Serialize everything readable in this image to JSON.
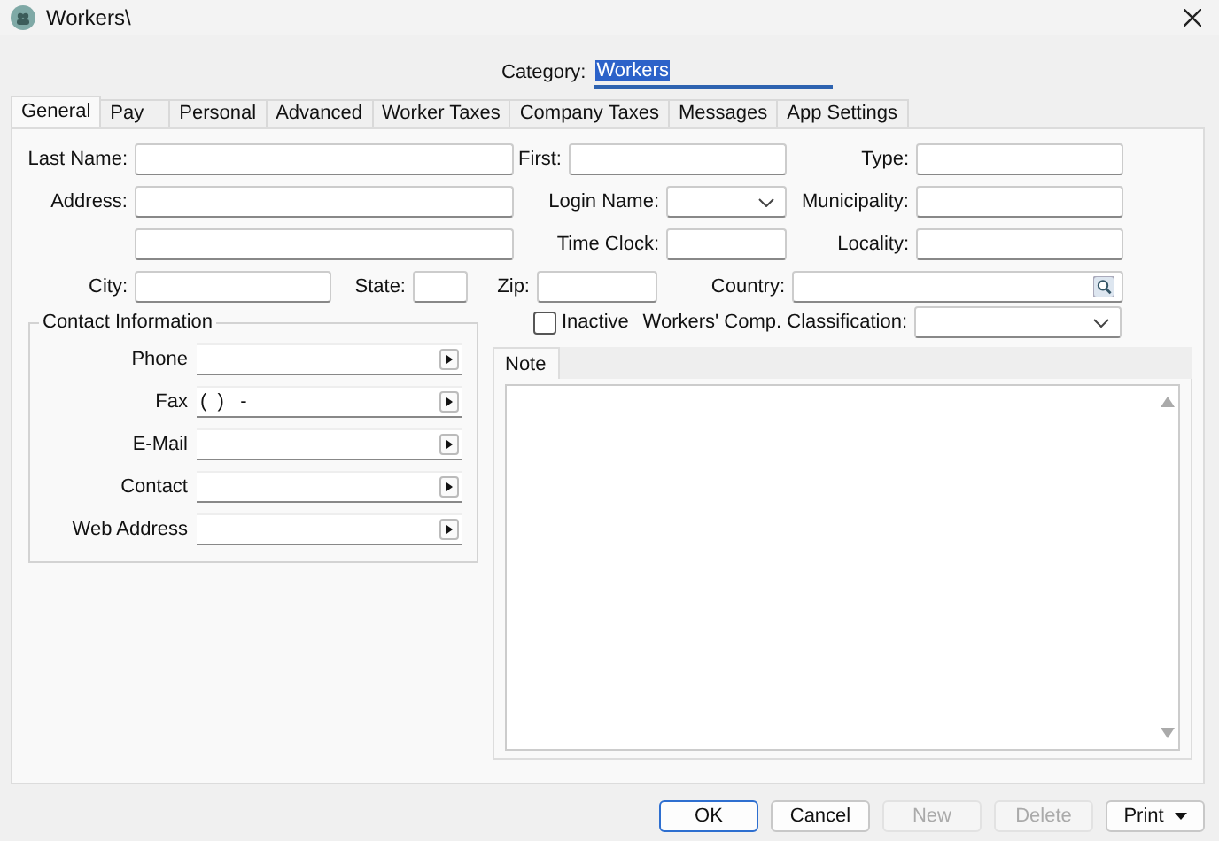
{
  "window": {
    "title": "Workers\\"
  },
  "category": {
    "label": "Category:",
    "value": "Workers",
    "highlighted": true
  },
  "tabs": [
    {
      "label": "General",
      "selected": true
    },
    {
      "label": "Pay",
      "selected": false
    },
    {
      "label": "Personal",
      "selected": false
    },
    {
      "label": "Advanced",
      "selected": false
    },
    {
      "label": "Worker Taxes",
      "selected": false
    },
    {
      "label": "Company Taxes",
      "selected": false
    },
    {
      "label": "Messages",
      "selected": false
    },
    {
      "label": "App Settings",
      "selected": false
    }
  ],
  "form_rows": [
    [
      {
        "label": "Last Name:",
        "kind": "text"
      },
      {
        "label": "First:",
        "kind": "text"
      },
      {
        "label": "Type:",
        "kind": "text"
      }
    ],
    [
      {
        "label": "Address:",
        "kind": "text"
      },
      {
        "label": "Login Name:",
        "kind": "select"
      },
      {
        "label": "Municipality:",
        "kind": "text"
      }
    ],
    [
      {
        "kind": "text"
      },
      {
        "label": "Time Clock:",
        "kind": "text"
      },
      {
        "label": "Locality:",
        "kind": "text"
      }
    ],
    [
      {
        "label": "City:",
        "kind": "text"
      },
      {
        "label": "State:",
        "kind": "text"
      },
      {
        "label": "Zip:",
        "kind": "text"
      },
      {
        "label": "Country:",
        "kind": "lookup"
      }
    ]
  ],
  "contact": {
    "title": "Contact Information",
    "rows": [
      {
        "label": "Phone"
      },
      {
        "label": "Fax",
        "value": "(  )   -"
      },
      {
        "label": "E-Mail"
      },
      {
        "label": "Contact"
      },
      {
        "label": "Web Address"
      }
    ]
  },
  "inactive": {
    "label": "Inactive",
    "checked": false
  },
  "comp_class": {
    "label": "Workers' Comp. Classification:",
    "kind": "select"
  },
  "note": {
    "tab": "Note"
  },
  "buttons": [
    {
      "label": "OK",
      "kind": "default",
      "disabled": false
    },
    {
      "label": "Cancel",
      "kind": "plain",
      "disabled": false
    },
    {
      "label": "New",
      "kind": "plain",
      "disabled": true
    },
    {
      "label": "Delete",
      "kind": "plain",
      "disabled": true
    },
    {
      "label": "Print",
      "kind": "menu",
      "disabled": false
    }
  ]
}
